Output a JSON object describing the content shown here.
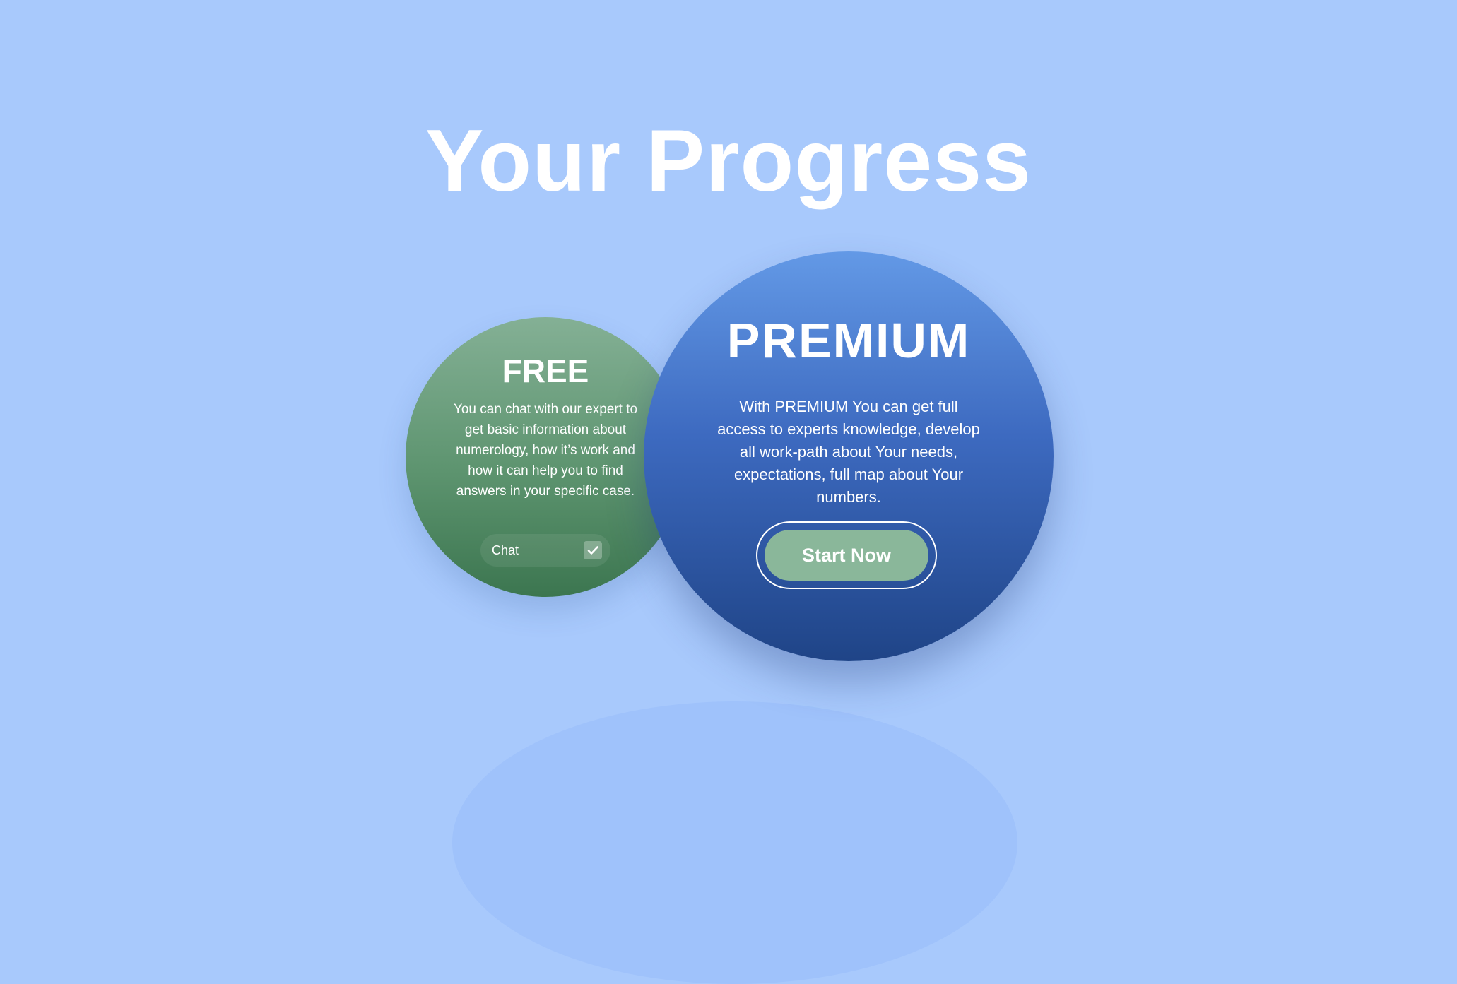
{
  "header": {
    "title": "Your Progress"
  },
  "plans": {
    "free": {
      "title": "FREE",
      "description": "You can chat with our expert to get basic information about numerology, how it’s work and how it can help you to find answers in your specific case.",
      "feature_label": "Chat",
      "feature_checked": true,
      "icon": "check-icon"
    },
    "premium": {
      "title": "PREMIUM",
      "description": "With PREMIUM You can get full access to experts knowledge, develop all work-path about Your needs, expectations, full map about Your numbers.",
      "cta_label": "Start Now"
    }
  },
  "colors": {
    "background": "#a8c9fc",
    "free_top": "#84b095",
    "free_bottom": "#3c7650",
    "premium_top": "#6399e6",
    "premium_bottom": "#1f4487",
    "cta": "#8ab79a"
  }
}
